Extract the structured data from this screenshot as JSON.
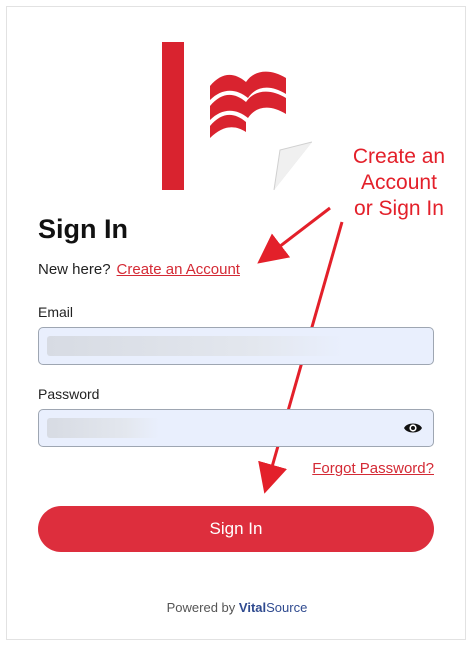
{
  "annotation": {
    "line1": "Create an",
    "line2": "Account",
    "line3": "or Sign In"
  },
  "form": {
    "title": "Sign In",
    "new_here": "New here?",
    "create_account_link": "Create an Account",
    "email_label": "Email",
    "password_label": "Password",
    "forgot_link": "Forgot Password?",
    "signin_button": "Sign In"
  },
  "footer": {
    "powered_by": "Powered by",
    "brand_vital": "Vital",
    "brand_source": "Source"
  },
  "colors": {
    "brand_red": "#dd2e3d",
    "link_red": "#d42a35",
    "annotation_red": "#e3202a",
    "field_bg": "#e9effd"
  },
  "icons": {
    "logo": "publisher-logo",
    "password_toggle": "eye-icon"
  }
}
